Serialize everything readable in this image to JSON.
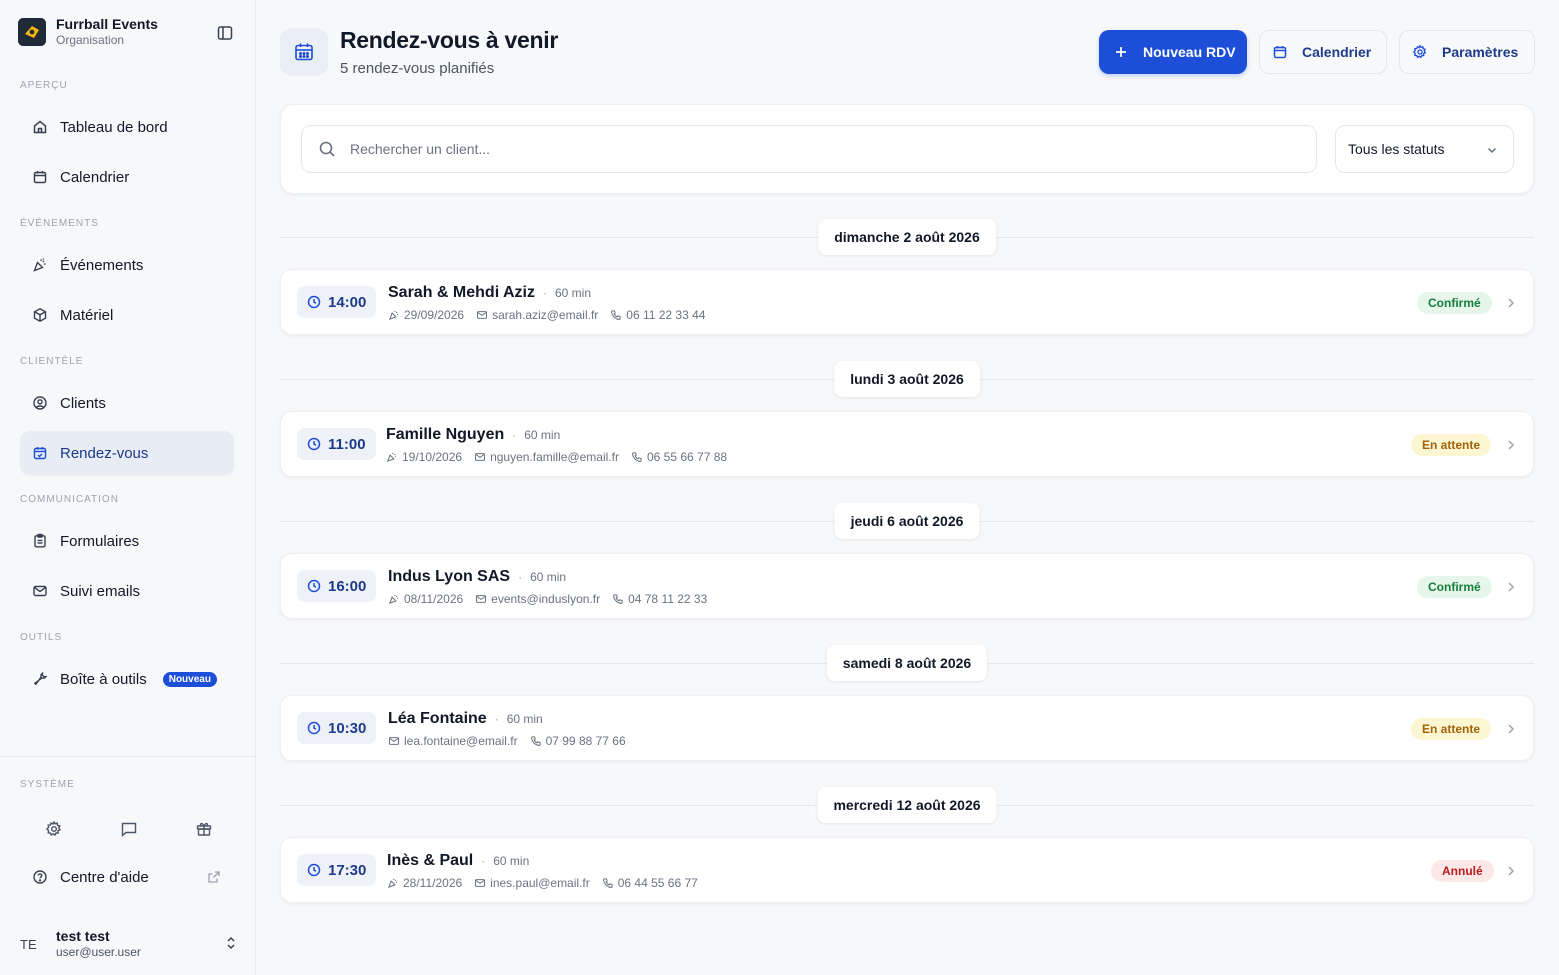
{
  "brand": {
    "name": "Furrball Events",
    "subtitle": "Organisation"
  },
  "sidebar": {
    "sections": [
      {
        "label": "APERÇU"
      },
      {
        "label": "ÉVÉNEMENTS"
      },
      {
        "label": "CLIENTÈLE"
      },
      {
        "label": "COMMUNICATION"
      },
      {
        "label": "OUTILS"
      },
      {
        "label": "SYSTÈME"
      }
    ],
    "items": [
      {
        "label": "Tableau de bord",
        "icon": "home-icon"
      },
      {
        "label": "Calendrier",
        "icon": "calendar-icon"
      },
      {
        "label": "Événements",
        "icon": "party-popper-icon"
      },
      {
        "label": "Matériel",
        "icon": "package-icon"
      },
      {
        "label": "Clients",
        "icon": "user-circle-icon"
      },
      {
        "label": "Rendez-vous",
        "icon": "calendar-check-icon",
        "active": true
      },
      {
        "label": "Formulaires",
        "icon": "clipboard-icon"
      },
      {
        "label": "Suivi emails",
        "icon": "mail-icon"
      },
      {
        "label": "Boîte à outils",
        "icon": "wrench-icon",
        "badge": "Nouveau"
      }
    ],
    "help": {
      "label": "Centre d'aide"
    },
    "user": {
      "initials": "TE",
      "name": "test test",
      "email": "user@user.user"
    }
  },
  "header": {
    "title": "Rendez-vous à venir",
    "subtitle": "5 rendez-vous planifiés",
    "new_label": "Nouveau RDV",
    "calendar_label": "Calendrier",
    "settings_label": "Paramètres"
  },
  "filters": {
    "search_placeholder": "Rechercher un client...",
    "status_value": "Tous les statuts"
  },
  "days": [
    {
      "date": "dimanche 2 août 2026",
      "appointments": [
        {
          "time": "14:00",
          "name": "Sarah & Mehdi Aziz",
          "duration": "60 min",
          "event_date": "29/09/2026",
          "email": "sarah.aziz@email.fr",
          "phone": "06 11 22 33 44",
          "status": "Confirmé",
          "status_type": "confirmed"
        }
      ]
    },
    {
      "date": "lundi 3 août 2026",
      "appointments": [
        {
          "time": "11:00",
          "name": "Famille Nguyen",
          "duration": "60 min",
          "event_date": "19/10/2026",
          "email": "nguyen.famille@email.fr",
          "phone": "06 55 66 77 88",
          "status": "En attente",
          "status_type": "pending"
        }
      ]
    },
    {
      "date": "jeudi 6 août 2026",
      "appointments": [
        {
          "time": "16:00",
          "name": "Indus Lyon SAS",
          "duration": "60 min",
          "event_date": "08/11/2026",
          "email": "events@induslyon.fr",
          "phone": "04 78 11 22 33",
          "status": "Confirmé",
          "status_type": "confirmed"
        }
      ]
    },
    {
      "date": "samedi 8 août 2026",
      "appointments": [
        {
          "time": "10:30",
          "name": "Léa Fontaine",
          "duration": "60 min",
          "email": "lea.fontaine@email.fr",
          "phone": "07 99 88 77 66",
          "status": "En attente",
          "status_type": "pending"
        }
      ]
    },
    {
      "date": "mercredi 12 août 2026",
      "appointments": [
        {
          "time": "17:30",
          "name": "Inès & Paul",
          "duration": "60 min",
          "event_date": "28/11/2026",
          "email": "ines.paul@email.fr",
          "phone": "06 44 55 66 77",
          "status": "Annulé",
          "status_type": "cancelled"
        }
      ]
    }
  ],
  "colors": {
    "accent": "#1d4ed8",
    "confirmed": "#15803d",
    "pending": "#a16207",
    "cancelled": "#b91c1c"
  }
}
